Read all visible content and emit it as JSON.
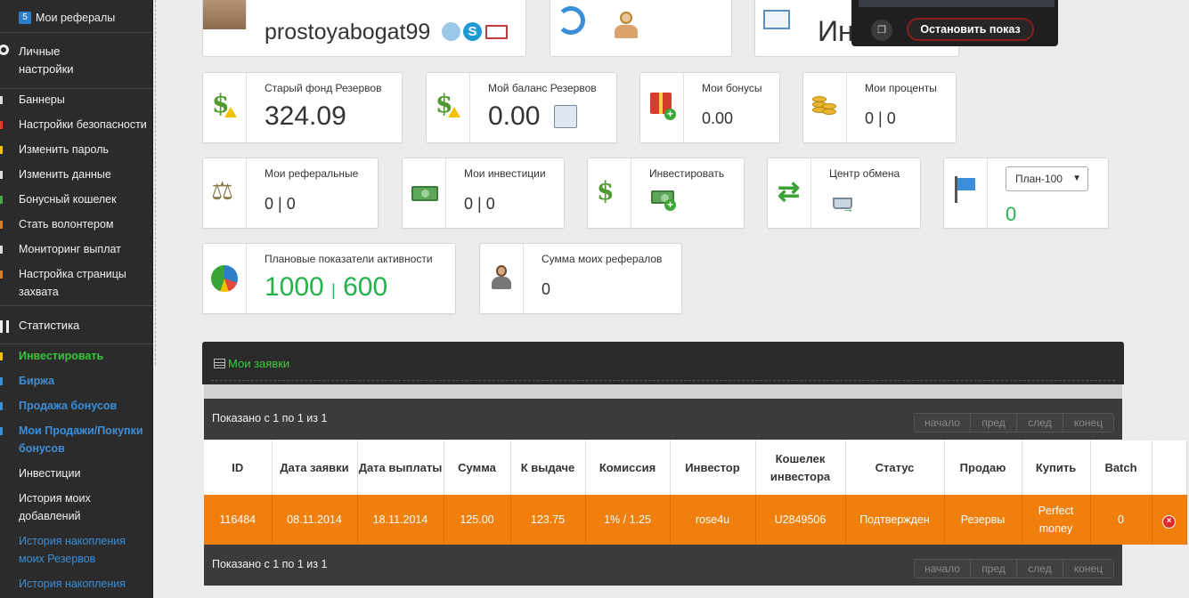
{
  "sidebar": {
    "top_item": {
      "badge": "5",
      "label": "Мои рефералы"
    },
    "personal_settings": "Личные настройки",
    "items": [
      {
        "label": "Баннеры",
        "color": "#dddddd"
      },
      {
        "label": "Настройки безопасности",
        "color": "#e23b2e"
      },
      {
        "label": "Изменить пароль",
        "color": "#f2c200"
      },
      {
        "label": "Изменить данные",
        "color": "#dddddd"
      },
      {
        "label": "Бонусный кошелек",
        "color": "#4aa54a"
      },
      {
        "label": "Стать волонтером",
        "color": "#e07b1a"
      },
      {
        "label": "Мониторинг выплат",
        "color": "#dddddd"
      },
      {
        "label": "Настройка страницы захвата",
        "color": "#e07b1a"
      }
    ],
    "statistics": "Статистика",
    "links": [
      {
        "label": "Инвестировать",
        "style": "green"
      },
      {
        "label": "Биржа",
        "style": "blue"
      },
      {
        "label": "Продажа бонусов",
        "style": "blue"
      },
      {
        "label": "Мои Продажи/Покупки бонусов",
        "style": "blue"
      },
      {
        "label": "Инвестиции",
        "style": "white"
      },
      {
        "label": "История моих добавлений",
        "style": "white"
      },
      {
        "label": "История накопления моих Резервов",
        "style": "blueplain"
      },
      {
        "label": "История накопления",
        "style": "blueplain"
      }
    ]
  },
  "profile": {
    "username": "prostoyabogat99",
    "partial_value": "Ин"
  },
  "overlay": {
    "stop_label": "Остановить показ",
    "icon": "window-icon"
  },
  "cards": {
    "old_fund": {
      "title": "Старый фонд Резервов",
      "value": "324.09"
    },
    "reserve_balance": {
      "title": "Мой баланс Резервов",
      "value": "0.00"
    },
    "bonuses": {
      "title": "Мои бонусы",
      "value": "0.00"
    },
    "percents": {
      "title": "Мои проценты",
      "value": "0 | 0"
    },
    "referrals": {
      "title": "Мои реферальные",
      "value": "0 | 0"
    },
    "investments": {
      "title": "Мои инвестиции",
      "value": "0 | 0"
    },
    "invest": {
      "title": "Инвестировать"
    },
    "exchange": {
      "title": "Центр обмена"
    },
    "plan": {
      "selected": "План-100",
      "value": "0"
    },
    "activity": {
      "title": "Плановые показатели активности",
      "value_a": "1000",
      "sep": "|",
      "value_b": "600"
    },
    "referral_sum": {
      "title": "Сумма моих рефералов",
      "value": "0"
    }
  },
  "orders": {
    "title": "Мои заявки",
    "info_top": "Показано с 1 по 1 из 1",
    "info_bottom": "Показано с 1 по 1 из 1",
    "pager": [
      "начало",
      "пред",
      "след",
      "конец"
    ],
    "columns": [
      "ID",
      "Дата заявки",
      "Дата выплаты",
      "Сумма",
      "К выдаче",
      "Комиссия",
      "Инвестор",
      "Кошелек инвестора",
      "Статус",
      "Продаю",
      "Купить",
      "Batch",
      ""
    ],
    "rows": [
      [
        "116484",
        "08.11.2014",
        "18.11.2014",
        "125.00",
        "123.75",
        "1% / 1.25",
        "rose4u",
        "U2849506",
        "Подтвержден",
        "Резервы",
        "Perfect money",
        "0"
      ]
    ]
  },
  "colors": {
    "accent_green": "#24b24b",
    "row_orange": "#f07f0d",
    "sidebar_bg": "#2b2b2b"
  }
}
